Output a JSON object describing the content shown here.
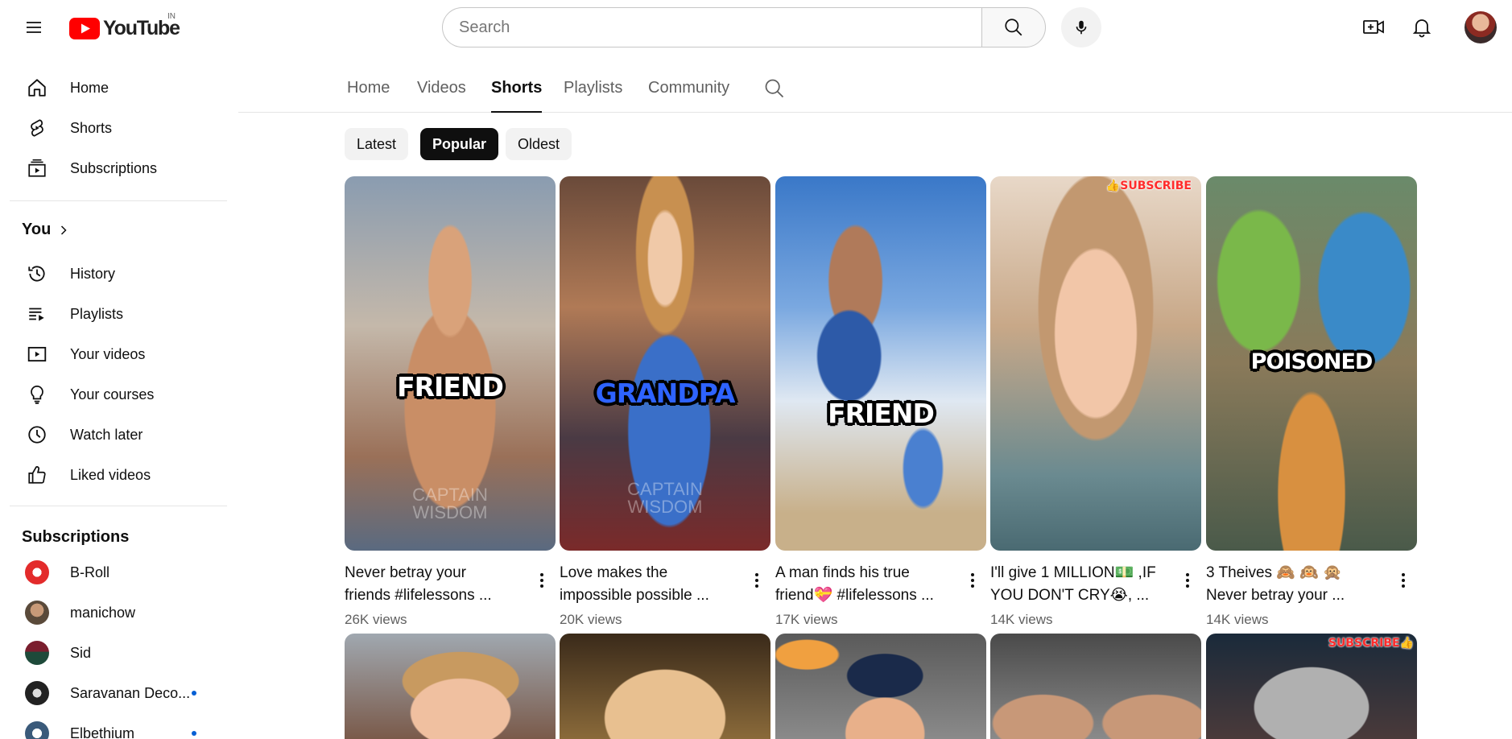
{
  "topbar": {
    "logo_text": "YouTube",
    "country_code": "IN",
    "search_placeholder": "Search",
    "icons": [
      "menu-icon",
      "search-icon",
      "mic-icon",
      "create-icon",
      "bell-icon"
    ]
  },
  "sidebar": {
    "main": [
      {
        "label": "Home",
        "icon": "home-icon"
      },
      {
        "label": "Shorts",
        "icon": "shorts-icon"
      },
      {
        "label": "Subscriptions",
        "icon": "subscriptions-icon"
      }
    ],
    "you_label": "You",
    "you_items": [
      {
        "label": "History",
        "icon": "history-icon"
      },
      {
        "label": "Playlists",
        "icon": "playlists-icon"
      },
      {
        "label": "Your videos",
        "icon": "your-videos-icon"
      },
      {
        "label": "Your courses",
        "icon": "courses-icon"
      },
      {
        "label": "Watch later",
        "icon": "watch-later-icon"
      },
      {
        "label": "Liked videos",
        "icon": "like-icon"
      }
    ],
    "subscriptions_title": "Subscriptions",
    "subscriptions": [
      {
        "label": "B-Roll",
        "new": false,
        "color": "#e32b2b"
      },
      {
        "label": "manichow",
        "new": false,
        "color": "#5a4a3a"
      },
      {
        "label": "Sid",
        "new": false,
        "color": "#1e4a3a"
      },
      {
        "label": "Saravanan Deco...",
        "new": true,
        "color": "#222222"
      },
      {
        "label": "Elbethium",
        "new": true,
        "color": "#3a5a7a"
      }
    ]
  },
  "tabs": [
    {
      "label": "Home",
      "active": false
    },
    {
      "label": "Videos",
      "active": false
    },
    {
      "label": "Shorts",
      "active": true
    },
    {
      "label": "Playlists",
      "active": false
    },
    {
      "label": "Community",
      "active": false
    }
  ],
  "chips": [
    {
      "label": "Latest",
      "active": false
    },
    {
      "label": "Popular",
      "active": true
    },
    {
      "label": "Oldest",
      "active": false
    }
  ],
  "shorts": [
    {
      "title_line1": "Never betray your",
      "title_line2": "friends #lifelessons ...",
      "views": "26K views",
      "overlay": "FRIEND",
      "watermark": "CAPTAIN\nWISDOM"
    },
    {
      "title_line1": "Love makes the",
      "title_line2": "impossible possible ...",
      "views": "20K views",
      "overlay": "GRANDPA",
      "watermark": "CAPTAIN\nWISDOM"
    },
    {
      "title_line1": "A man finds his true",
      "title_line2": "friend💝 #lifelessons ...",
      "views": "17K views",
      "overlay": "FRIEND",
      "watermark": ""
    },
    {
      "title_line1": "I'll give 1 MILLION💵 ,IF",
      "title_line2": "YOU DON'T CRY😭, ...",
      "views": "14K views",
      "overlay": "",
      "badge": "👍SUBSCRIBE",
      "watermark": ""
    },
    {
      "title_line1": "3 Theives 🙈 🙉 🙊",
      "title_line2": "Never betray your ...",
      "views": "14K views",
      "overlay": "POISONED",
      "watermark": ""
    }
  ],
  "row2_badge": "SUBSCRIBE👍",
  "colors": {
    "brand_red": "#ff0000",
    "text_primary": "#0f0f0f",
    "text_secondary": "#606060",
    "chip_bg": "#f2f2f2",
    "accent_blue": "#065fd4"
  }
}
